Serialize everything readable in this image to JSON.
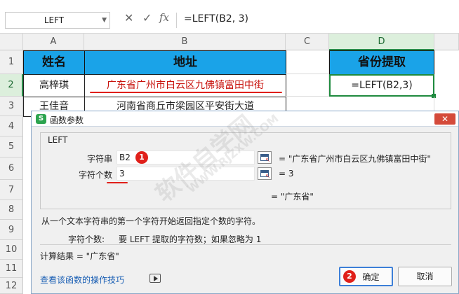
{
  "formula_bar": {
    "name_box": "LEFT",
    "cancel_icon": "✕",
    "confirm_icon": "✓",
    "fx_label": "fx",
    "formula": "=LEFT(B2, 3)"
  },
  "sheet": {
    "columns": [
      "A",
      "B",
      "C",
      "D"
    ],
    "rows": [
      "1",
      "2",
      "3",
      "4",
      "5",
      "6",
      "7",
      "8",
      "9",
      "10",
      "11",
      "12"
    ],
    "header_row": {
      "a": "姓名",
      "b": "地址",
      "d": "省份提取"
    },
    "row2": {
      "a": "高梓琪",
      "b": "广东省广州市白云区九佛镇富田中街",
      "d": "=LEFT(B2,3)"
    },
    "row3": {
      "a": "王佳音",
      "b": "河南省商丘市梁园区平安街大道"
    },
    "colors": {
      "header_fill": "#1aa3e8",
      "active_border": "#1e8a3e",
      "annotation": "#e0201a"
    }
  },
  "dialog": {
    "title": "函数参数",
    "app_icon": "S",
    "close_icon": "✕",
    "function_name": "LEFT",
    "args": [
      {
        "label": "字符串",
        "value": "B2",
        "result": "= \"广东省广州市白云区九佛镇富田中街\"",
        "badge": "1"
      },
      {
        "label": "字符个数",
        "value": "3",
        "result": "= 3"
      }
    ],
    "overall_result": "= \"广东省\"",
    "description": "从一个文本字符串的第一个字符开始返回指定个数的字符。",
    "arg_help_label": "字符个数:",
    "arg_help_text": "要 LEFT 提取的字符数；如果忽略为 1",
    "calc_result": "计算结果 = \"广东省\"",
    "tips_link": "查看该函数的操作技巧",
    "ok_badge": "2",
    "ok_label": "确定",
    "cancel_label": "取消"
  },
  "watermark": {
    "line1": "软件自学网",
    "line2": "WWW.RJZXW.COM"
  }
}
